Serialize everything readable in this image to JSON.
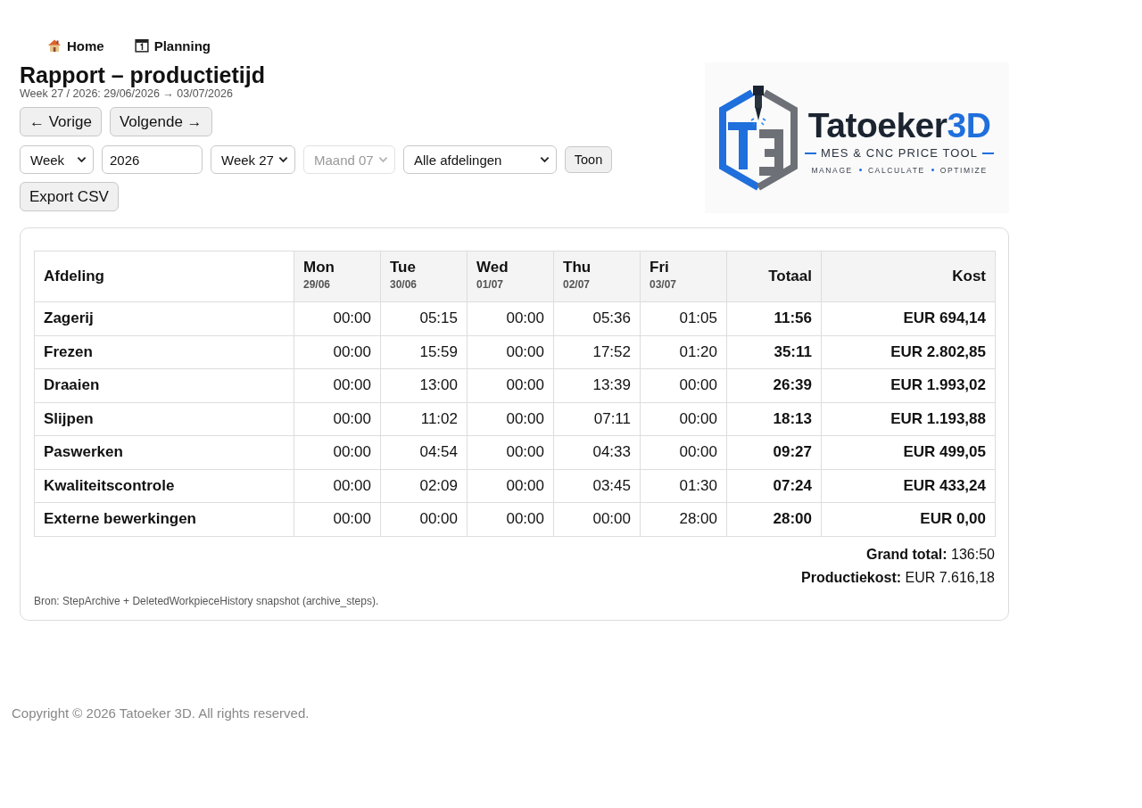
{
  "nav": [
    {
      "label": "Home"
    },
    {
      "label": "Planning"
    }
  ],
  "title": "Rapport – productietijd",
  "subtitle": "Week 27 / 2026: 29/06/2026 → 03/07/2026",
  "period_buttons": [
    "← Vorige",
    "Volgende →"
  ],
  "filters": [
    {
      "kind": "select",
      "value": "Week",
      "disabled": false
    },
    {
      "kind": "input",
      "value": "2026",
      "disabled": false
    },
    {
      "kind": "select",
      "value": "Week 27",
      "disabled": false
    },
    {
      "kind": "select",
      "value": "Maand 07",
      "disabled": true
    },
    {
      "kind": "select",
      "value": "Alle afdelingen",
      "disabled": false
    },
    {
      "kind": "button",
      "value": "Toon",
      "disabled": false
    }
  ],
  "export_button": "Export CSV",
  "logo": {
    "brand": "Tatoeker",
    "brand_accent": "3D",
    "tagline": "MES & CNC PRICE TOOL",
    "motto": [
      "MANAGE",
      "CALCULATE",
      "OPTIMIZE"
    ]
  },
  "table": {
    "columns": [
      {
        "kind": "name",
        "label": "Afdeling"
      },
      {
        "kind": "day",
        "label": "Mon",
        "date": "29/06"
      },
      {
        "kind": "day",
        "label": "Tue",
        "date": "30/06"
      },
      {
        "kind": "day",
        "label": "Wed",
        "date": "01/07"
      },
      {
        "kind": "day",
        "label": "Thu",
        "date": "02/07"
      },
      {
        "kind": "day",
        "label": "Fri",
        "date": "03/07"
      },
      {
        "kind": "total",
        "label": "Totaal"
      },
      {
        "kind": "cost",
        "label": "Kost"
      }
    ],
    "rows": [
      {
        "name": "Zagerij",
        "days": [
          "00:00",
          "05:15",
          "00:00",
          "05:36",
          "01:05"
        ],
        "total": "11:56",
        "cost": "EUR 694,14"
      },
      {
        "name": "Frezen",
        "days": [
          "00:00",
          "15:59",
          "00:00",
          "17:52",
          "01:20"
        ],
        "total": "35:11",
        "cost": "EUR 2.802,85"
      },
      {
        "name": "Draaien",
        "days": [
          "00:00",
          "13:00",
          "00:00",
          "13:39",
          "00:00"
        ],
        "total": "26:39",
        "cost": "EUR 1.993,02"
      },
      {
        "name": "Slijpen",
        "days": [
          "00:00",
          "11:02",
          "00:00",
          "07:11",
          "00:00"
        ],
        "total": "18:13",
        "cost": "EUR 1.193,88"
      },
      {
        "name": "Paswerken",
        "days": [
          "00:00",
          "04:54",
          "00:00",
          "04:33",
          "00:00"
        ],
        "total": "09:27",
        "cost": "EUR 499,05"
      },
      {
        "name": "Kwaliteitscontrole",
        "days": [
          "00:00",
          "02:09",
          "00:00",
          "03:45",
          "01:30"
        ],
        "total": "07:24",
        "cost": "EUR 433,24"
      },
      {
        "name": "Externe bewerkingen",
        "days": [
          "00:00",
          "00:00",
          "00:00",
          "00:00",
          "28:00"
        ],
        "total": "28:00",
        "cost": "EUR 0,00"
      }
    ]
  },
  "summary": [
    "**Grand total:** 136:50",
    "**Productiekost:** EUR 7.616,18"
  ],
  "source_note": "Bron: StepArchive + DeletedWorkpieceHistory snapshot (archive_steps).",
  "footer": "Copyright © 2026 Tatoeker 3D. All rights reserved."
}
